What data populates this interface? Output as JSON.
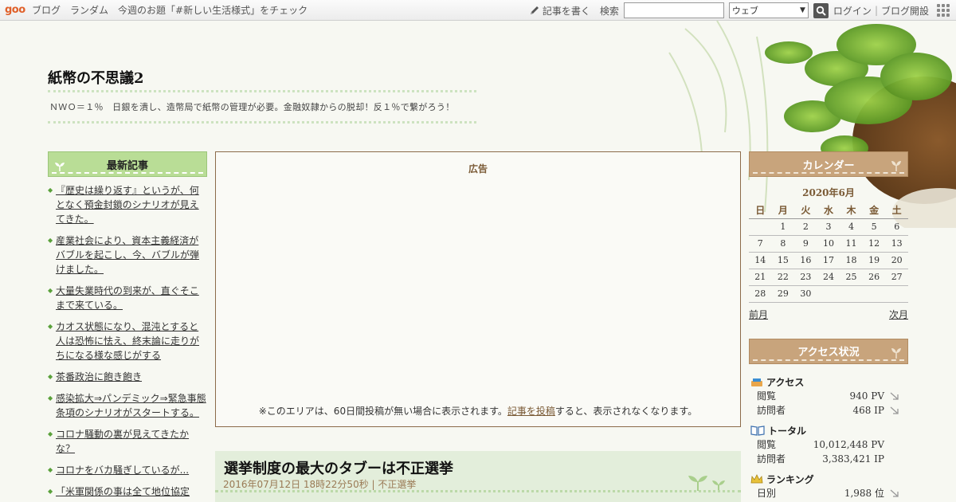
{
  "topbar": {
    "logo": "goo",
    "nav": [
      "ブログ",
      "ランダム",
      "今週のお題「#新しい生活様式」をチェック"
    ],
    "write_label": "記事を書く",
    "search_label": "検索",
    "search_value": "",
    "scope_selected": "ウェブ",
    "login_label": "ログイン",
    "open_blog_label": "ブログ開設"
  },
  "header": {
    "title": "紙幣の不思議2",
    "description": "ＮＷＯ＝１％　日銀を潰し、造幣局で紙幣の管理が必要。金融奴隷からの脱却！反１％で繋がろう！"
  },
  "recent": {
    "heading": "最新記事",
    "items": [
      "『歴史は繰り返す』というが、何となく預金封鎖のシナリオが見えてきた。",
      "産業社会により、資本主義経済がバブルを起こし、今、バブルが弾けました。",
      "大量失業時代の到来が、直ぐそこまで来ている。",
      "カオス状態になり、混沌とすると人は恐怖に怯え、終末論に走りがちになる様な感じがする",
      "茶番政治に飽き飽き",
      "感染拡大⇒パンデミック⇒緊急事態条項のシナリオがスタートする。",
      "コロナ騒動の裏が見えてきたかな？",
      "コロナをバカ騒ぎしているが...",
      "「米軍関係の事は全て地位協定"
    ]
  },
  "ad": {
    "label": "広告",
    "note_before": "※このエリアは、60日間投稿が無い場合に表示されます。",
    "note_link": "記事を投稿",
    "note_after": "すると、表示されなくなります。"
  },
  "article": {
    "title": "選挙制度の最大のタブーは不正選挙",
    "date": "2016年07月12日 18時22分50秒",
    "meta_sep": " | ",
    "category": "不正選挙"
  },
  "calendar": {
    "heading": "カレンダー",
    "month": "2020年6月",
    "weekdays": [
      "日",
      "月",
      "火",
      "水",
      "木",
      "金",
      "土"
    ],
    "weeks": [
      [
        "",
        "1",
        "2",
        "3",
        "4",
        "5",
        "6"
      ],
      [
        "7",
        "8",
        "9",
        "10",
        "11",
        "12",
        "13"
      ],
      [
        "14",
        "15",
        "16",
        "17",
        "18",
        "19",
        "20"
      ],
      [
        "21",
        "22",
        "23",
        "24",
        "25",
        "26",
        "27"
      ],
      [
        "28",
        "29",
        "30",
        "",
        "",
        "",
        ""
      ]
    ],
    "prev": "前月",
    "next": "次月"
  },
  "access": {
    "heading": "アクセス状況",
    "groups": [
      {
        "title": "アクセス",
        "icon": "access-icon",
        "rows": [
          {
            "k": "閲覧",
            "v": "940 PV",
            "arrow": true
          },
          {
            "k": "訪問者",
            "v": "468 IP",
            "arrow": true
          }
        ]
      },
      {
        "title": "トータル",
        "icon": "book-icon",
        "rows": [
          {
            "k": "閲覧",
            "v": "10,012,448 PV",
            "arrow": false
          },
          {
            "k": "訪問者",
            "v": "3,383,421 IP",
            "arrow": false
          }
        ]
      },
      {
        "title": "ランキング",
        "icon": "crown-icon",
        "rows": [
          {
            "k": "日別",
            "v": "1,988 位",
            "arrow": true
          }
        ]
      }
    ]
  },
  "colors": {
    "green_head": "#b9dd96",
    "brown_head": "#c8a47c",
    "accent_brown": "#7a5a35",
    "goo_orange": "#e0602a"
  }
}
